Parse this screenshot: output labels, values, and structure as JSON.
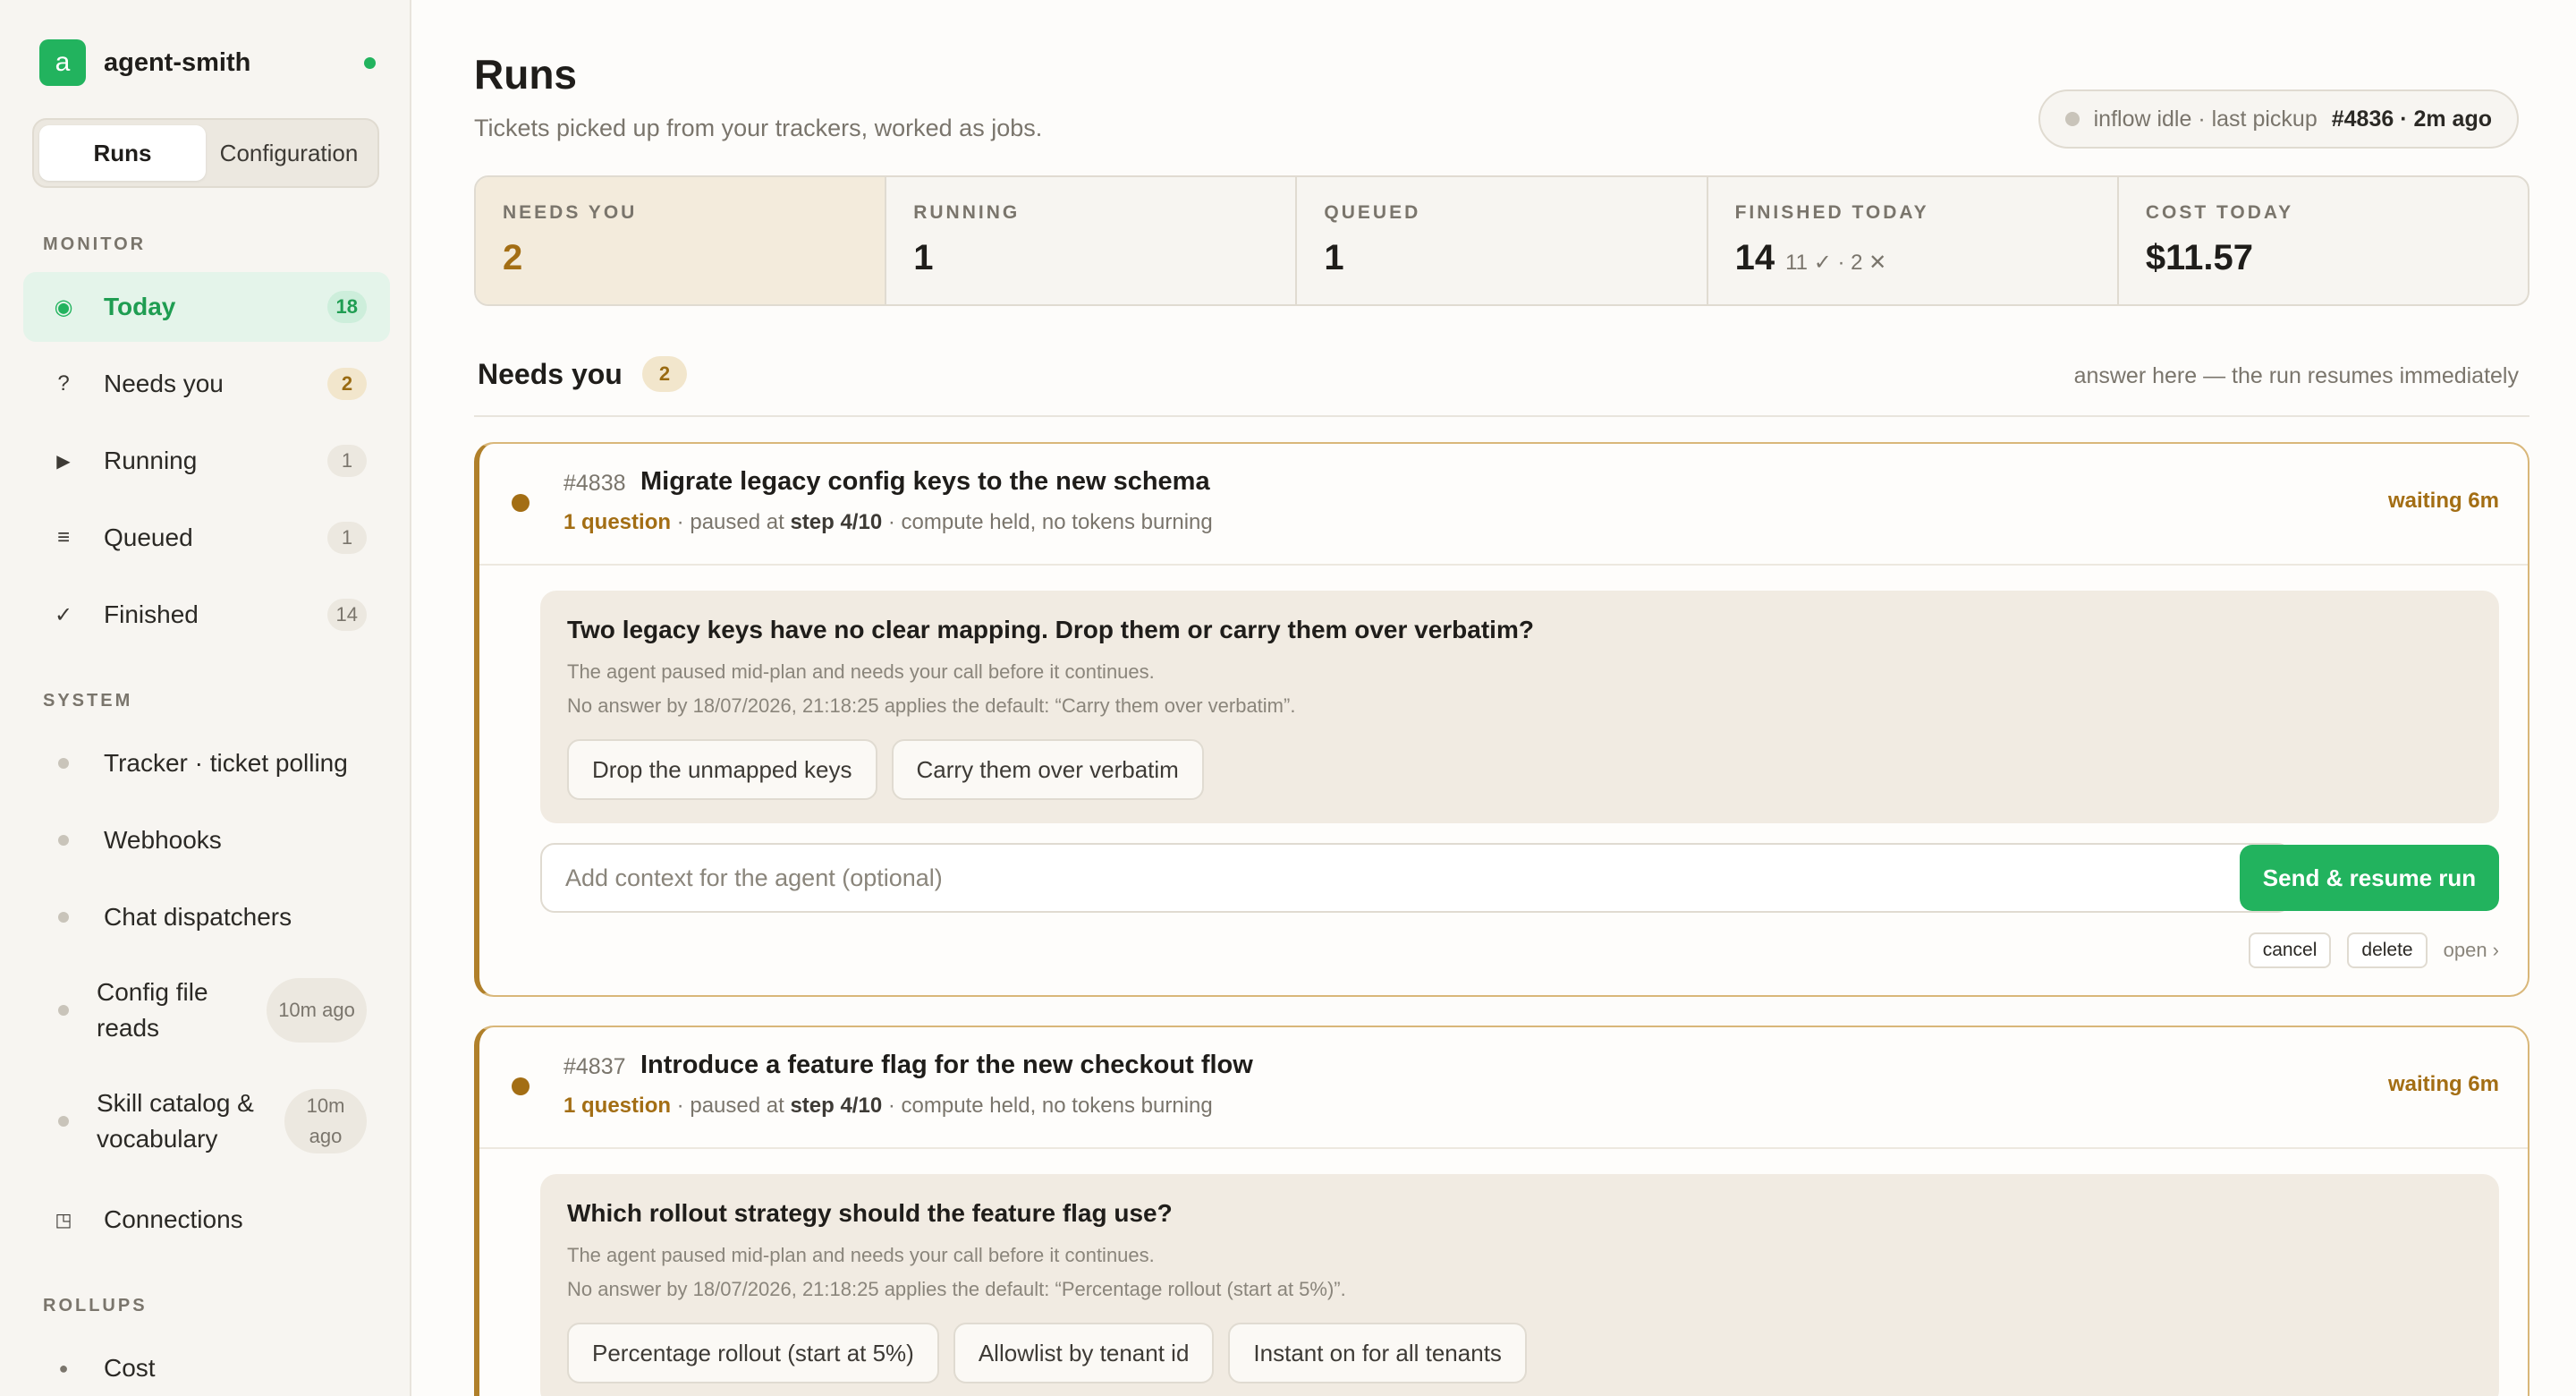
{
  "sidebar": {
    "brand": {
      "logo_letter": "a",
      "name": "agent-smith"
    },
    "tabs": [
      {
        "label": "Runs",
        "active": true
      },
      {
        "label": "Configuration",
        "active": false
      }
    ],
    "sections": {
      "monitor": "MONITOR",
      "system": "SYSTEM",
      "rollups": "ROLLUPS"
    },
    "monitor_items": [
      {
        "icon": "target-icon",
        "glyph": "◉",
        "label": "Today",
        "count": "18",
        "active": true
      },
      {
        "icon": "question-icon",
        "glyph": "?",
        "label": "Needs you",
        "count": "2"
      },
      {
        "icon": "play-icon",
        "glyph": "▶",
        "label": "Running",
        "count": "1"
      },
      {
        "icon": "list-icon",
        "glyph": "≡",
        "label": "Queued",
        "count": "1"
      },
      {
        "icon": "check-icon",
        "glyph": "✓",
        "label": "Finished",
        "count": "14"
      }
    ],
    "system_items": [
      {
        "label": "Tracker · ticket polling"
      },
      {
        "label": "Webhooks"
      },
      {
        "label": "Chat dispatchers"
      },
      {
        "label": "Config file reads",
        "age": "10m ago"
      },
      {
        "label": "Skill catalog & vocabulary",
        "age": "10m ago"
      },
      {
        "label": "Connections",
        "glyph": "◳"
      }
    ],
    "rollup_items": [
      {
        "label": "Cost",
        "glyph": "●"
      }
    ]
  },
  "header": {
    "title": "Runs",
    "subtitle": "Tickets picked up from your trackers, worked as jobs.",
    "status": {
      "text": "inflow idle · last pickup",
      "strong": "#4836 · 2m ago"
    }
  },
  "stats": [
    {
      "label": "NEEDS YOU",
      "value": "2"
    },
    {
      "label": "RUNNING",
      "value": "1"
    },
    {
      "label": "QUEUED",
      "value": "1"
    },
    {
      "label": "FINISHED TODAY",
      "value": "14",
      "extra": "11 ✓ · 2 ✕"
    },
    {
      "label": "COST TODAY",
      "value": "$11.57"
    }
  ],
  "needs_you": {
    "title": "Needs you",
    "count": "2",
    "hint": "answer here — the run resumes immediately"
  },
  "cards": [
    {
      "id": "#4838",
      "title": "Migrate legacy config keys to the new schema",
      "meta_question": "1 question",
      "meta_paused": " · paused at ",
      "meta_step": "step 4/10",
      "meta_rest": " · compute held, no tokens burning",
      "waiting": "waiting 6m",
      "question": "Two legacy keys have no clear mapping. Drop them or carry them over verbatim?",
      "line1": "The agent paused mid-plan and needs your call before it continues.",
      "line2": "No answer by 18/07/2026, 21:18:25 applies the default: “Carry them over verbatim”.",
      "options": [
        "Drop the unmapped keys",
        "Carry them over verbatim"
      ],
      "input_placeholder": "Add context for the agent (optional)",
      "send_label": "Send & resume run",
      "cancel_label": "cancel",
      "delete_label": "delete",
      "open_label": "open ›"
    },
    {
      "id": "#4837",
      "title": "Introduce a feature flag for the new checkout flow",
      "meta_question": "1 question",
      "meta_paused": " · paused at ",
      "meta_step": "step 4/10",
      "meta_rest": " · compute held, no tokens burning",
      "waiting": "waiting 6m",
      "question": "Which rollout strategy should the feature flag use?",
      "line1": "The agent paused mid-plan and needs your call before it continues.",
      "line2": "No answer by 18/07/2026, 21:18:25 applies the default: “Percentage rollout (start at 5%)”.",
      "options": [
        "Percentage rollout (start at 5%)",
        "Allowlist by tenant id",
        "Instant on for all tenants"
      ]
    }
  ]
}
